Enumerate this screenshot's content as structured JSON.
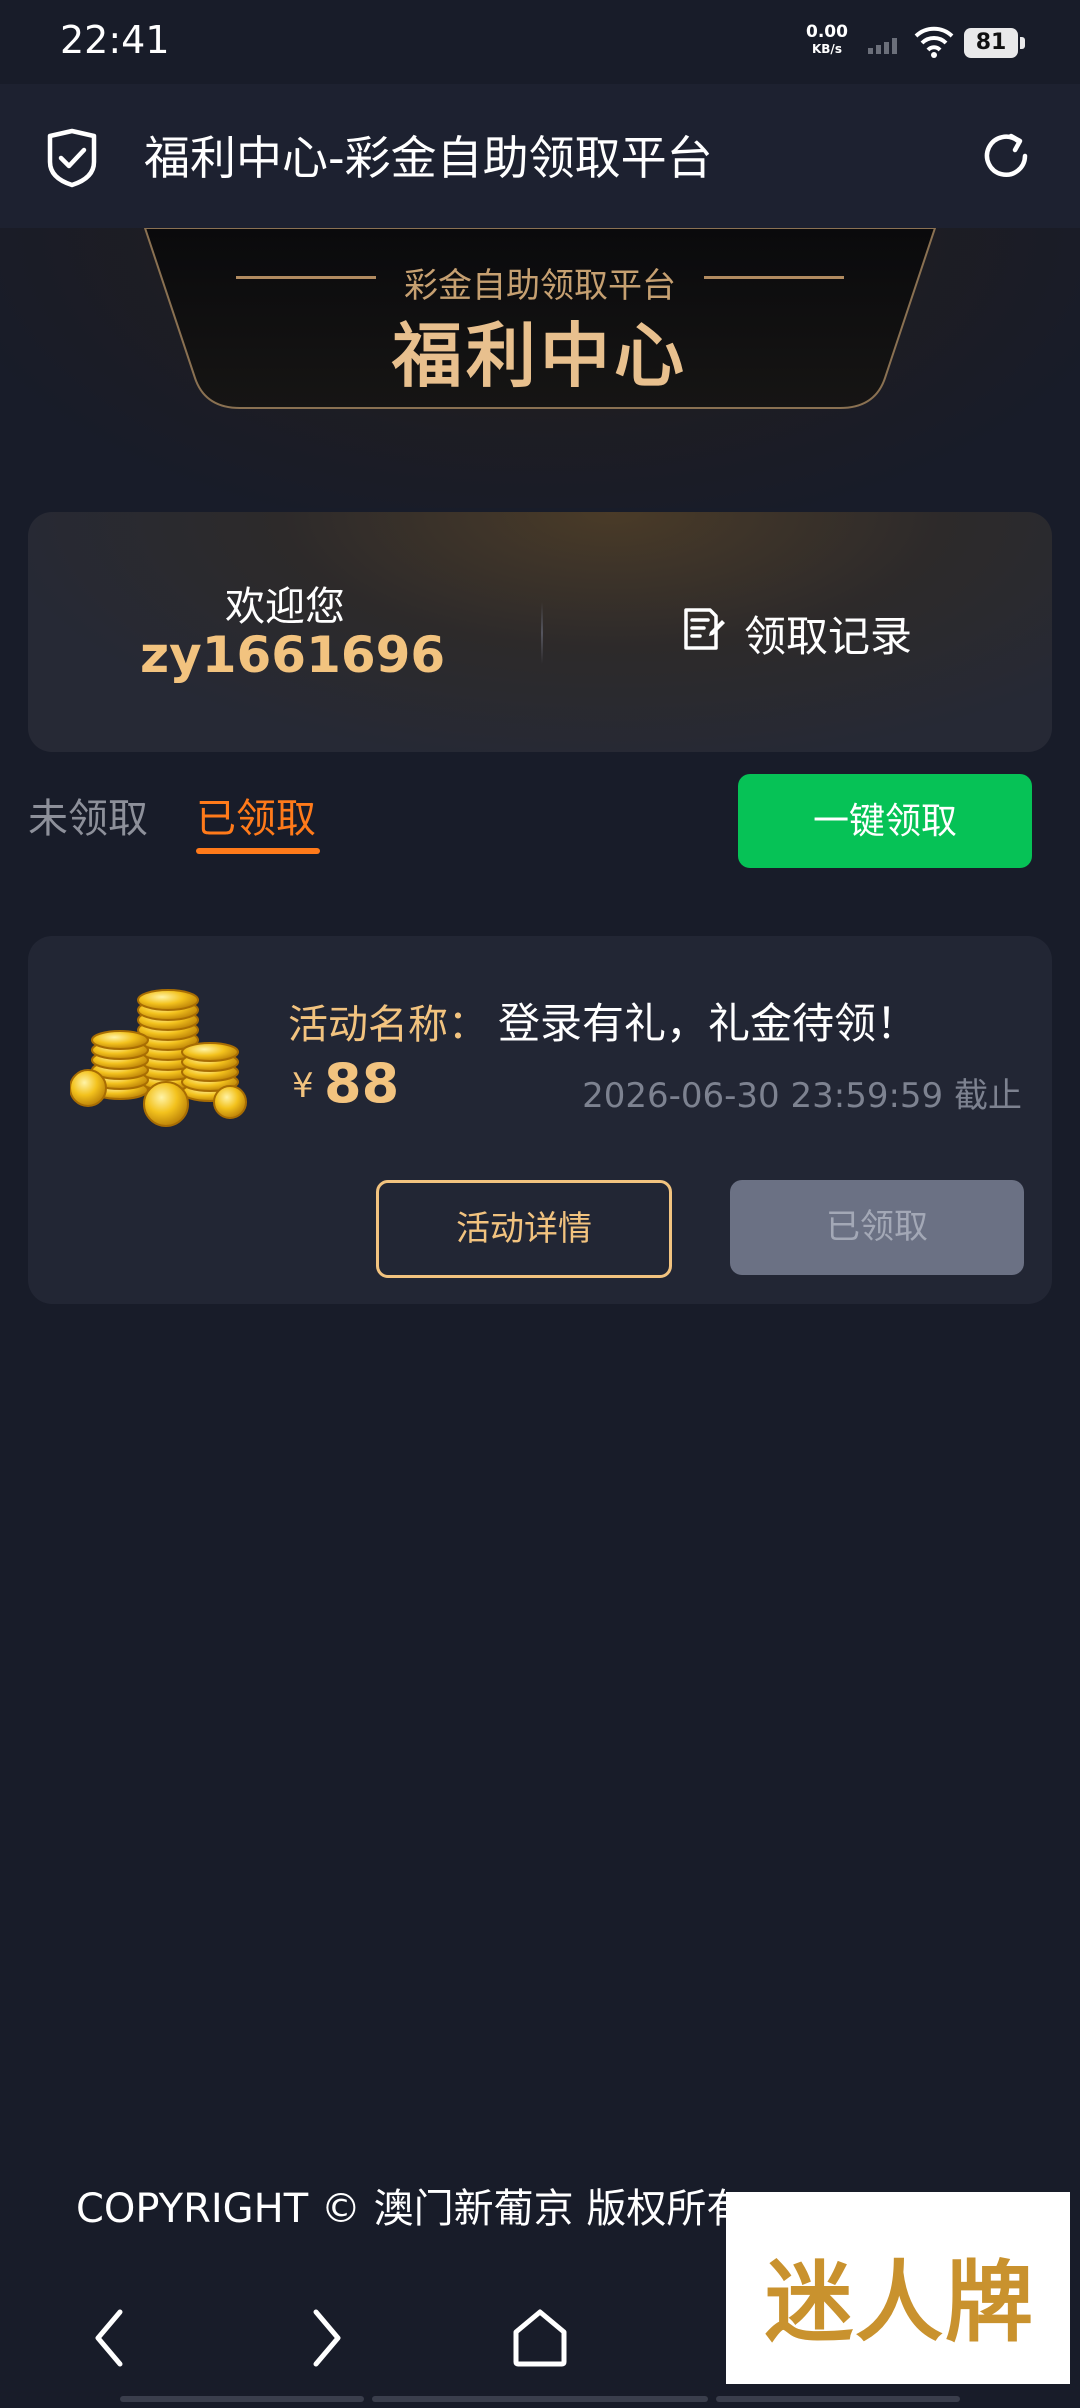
{
  "status_bar": {
    "time": "22:41",
    "net_speed": "0.00",
    "net_unit": "KB/s",
    "battery": "81"
  },
  "header": {
    "title": "福利中心-彩金自助领取平台"
  },
  "banner": {
    "subtitle": "彩金自助领取平台",
    "title": "福利中心"
  },
  "welcome": {
    "greeting": "欢迎您",
    "username": "zy1661696",
    "record_label": "领取记录"
  },
  "tabs": [
    {
      "label": "未领取",
      "active": false
    },
    {
      "label": "已领取",
      "active": true
    }
  ],
  "claim_all_label": "一键领取",
  "activity": {
    "name_label": "活动名称：",
    "name": "登录有礼，礼金待领！",
    "currency": "¥",
    "amount": "88",
    "deadline": "2026-06-30 23:59:59 截止",
    "detail_label": "活动详情",
    "status_label": "已领取"
  },
  "footer": {
    "copyright": "COPYRIGHT © 澳门新葡京 版权所有 RESERVED"
  },
  "watermark": "迷人牌",
  "colors": {
    "accent_orange": "#ff7a1a",
    "gold": "#f2c37f",
    "green": "#06c256",
    "background": "#181c29"
  }
}
